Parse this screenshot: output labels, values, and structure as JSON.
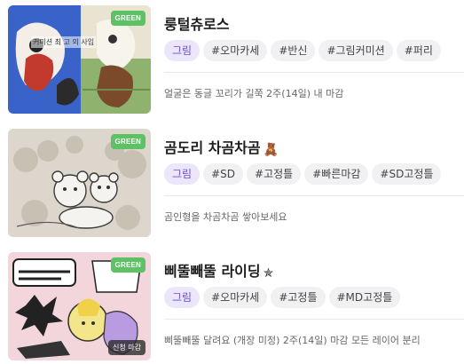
{
  "listings": [
    {
      "title": "룽털츄로스",
      "badge": "GREEN",
      "thumb_text": "커미션 최 고 의 사입",
      "tags": [
        "그림",
        "#오마카세",
        "#반신",
        "#그림커미션",
        "#퍼리"
      ],
      "description": "얼굴은 동글 꼬리가 길쭉 2주(14일) 내 마감"
    },
    {
      "title": "곰도리 차곰차곰",
      "title_emoji": "🧸",
      "badge": "GREEN",
      "tags": [
        "그림",
        "#SD",
        "#고정틀",
        "#빠른마감",
        "#SD고정틀"
      ],
      "description": "곰인형을 차곰차곰 쌓아보세요"
    },
    {
      "title": "삐뚤빼뚤 라이딩",
      "title_emoji": "✯",
      "badge": "GREEN",
      "badge_bottom": "신청 마감",
      "tags": [
        "그림",
        "#오마카세",
        "#고정틀",
        "#MD고정틀"
      ],
      "description": "삐뚤빼뚤 달려요 (개장 미정) 2주(14일) 마감 모든 레이어 분리"
    }
  ],
  "colors": {
    "green_badge": "#5cc264",
    "category_tag_bg": "#ece6fb",
    "category_tag_text": "#6a4fcf",
    "tag_bg": "#f1f1f3"
  }
}
